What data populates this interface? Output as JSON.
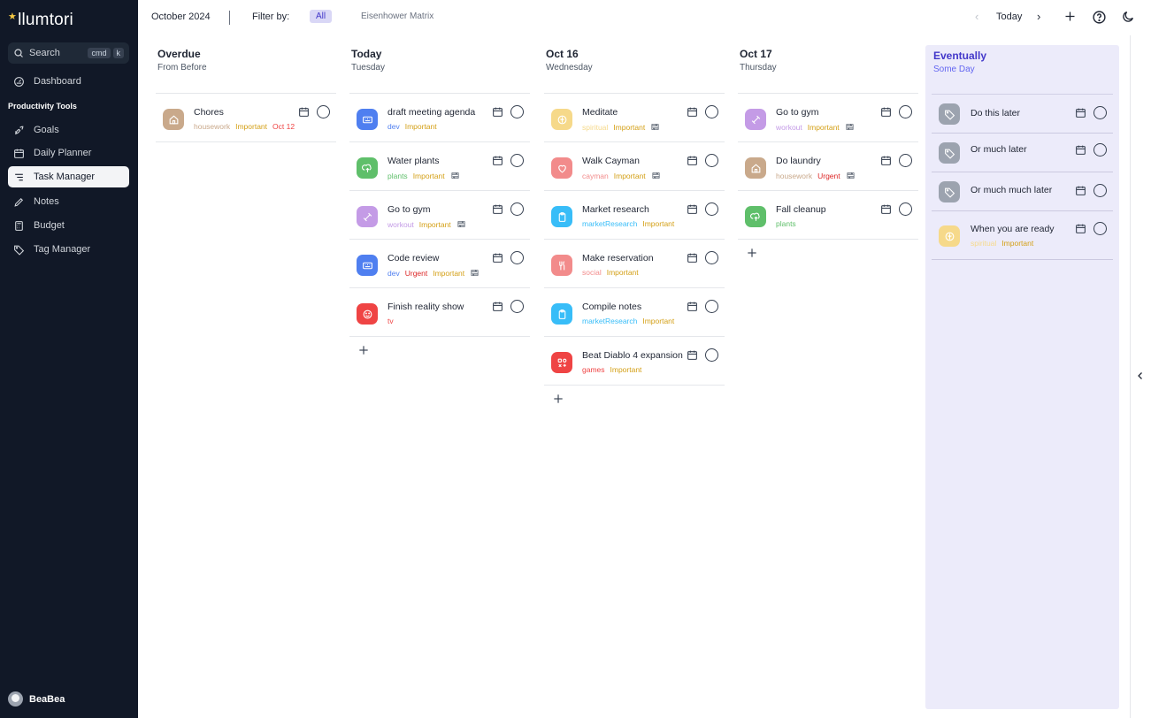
{
  "app": {
    "name": "llumtori"
  },
  "sidebar": {
    "search": {
      "label": "Search",
      "kbd1": "cmd",
      "kbd2": "k"
    },
    "dashboard": "Dashboard",
    "section": "Productivity Tools",
    "items": [
      {
        "label": "Goals",
        "icon": "rocket-icon"
      },
      {
        "label": "Daily Planner",
        "icon": "calendar-icon"
      },
      {
        "label": "Task Manager",
        "icon": "list-icon",
        "active": true
      },
      {
        "label": "Notes",
        "icon": "pencil-icon"
      },
      {
        "label": "Budget",
        "icon": "calculator-icon"
      },
      {
        "label": "Tag Manager",
        "icon": "tag-icon"
      }
    ],
    "user": "BeaBea"
  },
  "topbar": {
    "month": "October 2024",
    "filter_label": "Filter by:",
    "filter_all": "All",
    "eisenhower": "Eisenhower Matrix",
    "today": "Today"
  },
  "colors": {
    "housework": "#c9a98b",
    "dev": "#4f7ff0",
    "plants": "#5fbf6a",
    "workout": "#c49be6",
    "tv": "#ef4444",
    "spiritual": "#f6d98a",
    "cayman": "#f28b8b",
    "marketResearch": "#38bdf8",
    "social": "#f28b8b",
    "games": "#ef4444",
    "important": "#d4a017",
    "urgent": "#dc2626",
    "date": "#ef4444",
    "gray": "#9ca3af"
  },
  "columns": [
    {
      "title": "Overdue",
      "subtitle": "From Before",
      "tasks": [
        {
          "title": "Chores",
          "tags": [
            "housework",
            "Important",
            "Oct 12"
          ]
        }
      ]
    },
    {
      "title": "Today",
      "subtitle": "Tuesday",
      "tasks": [
        {
          "title": "draft meeting agenda",
          "tags": [
            "dev",
            "Important"
          ]
        },
        {
          "title": "Water plants",
          "tags": [
            "plants",
            "Important"
          ]
        },
        {
          "title": "Go to gym",
          "tags": [
            "workout",
            "Important"
          ]
        },
        {
          "title": "Code review",
          "tags": [
            "dev",
            "Urgent",
            "Important"
          ]
        },
        {
          "title": "Finish reality show",
          "tags": [
            "tv"
          ]
        }
      ]
    },
    {
      "title": "Oct 16",
      "subtitle": "Wednesday",
      "tasks": [
        {
          "title": "Meditate",
          "tags": [
            "spiritual",
            "Important"
          ]
        },
        {
          "title": "Walk Cayman",
          "tags": [
            "cayman",
            "Important"
          ]
        },
        {
          "title": "Market research",
          "tags": [
            "marketResearch",
            "Important"
          ]
        },
        {
          "title": "Make reservation",
          "tags": [
            "social",
            "Important"
          ]
        },
        {
          "title": "Compile notes",
          "tags": [
            "marketResearch",
            "Important"
          ]
        },
        {
          "title": "Beat Diablo 4 expansion",
          "tags": [
            "games",
            "Important"
          ]
        }
      ]
    },
    {
      "title": "Oct 17",
      "subtitle": "Thursday",
      "tasks": [
        {
          "title": "Go to gym",
          "tags": [
            "workout",
            "Important"
          ]
        },
        {
          "title": "Do laundry",
          "tags": [
            "housework",
            "Urgent"
          ]
        },
        {
          "title": "Fall cleanup",
          "tags": [
            "plants"
          ]
        }
      ]
    },
    {
      "title": "Eventually",
      "subtitle": "Some Day",
      "tasks": [
        {
          "title": "Do this later"
        },
        {
          "title": "Or much later"
        },
        {
          "title": "Or much much later"
        },
        {
          "title": "When you are ready",
          "tags": [
            "spiritual",
            "Important"
          ]
        }
      ]
    }
  ]
}
